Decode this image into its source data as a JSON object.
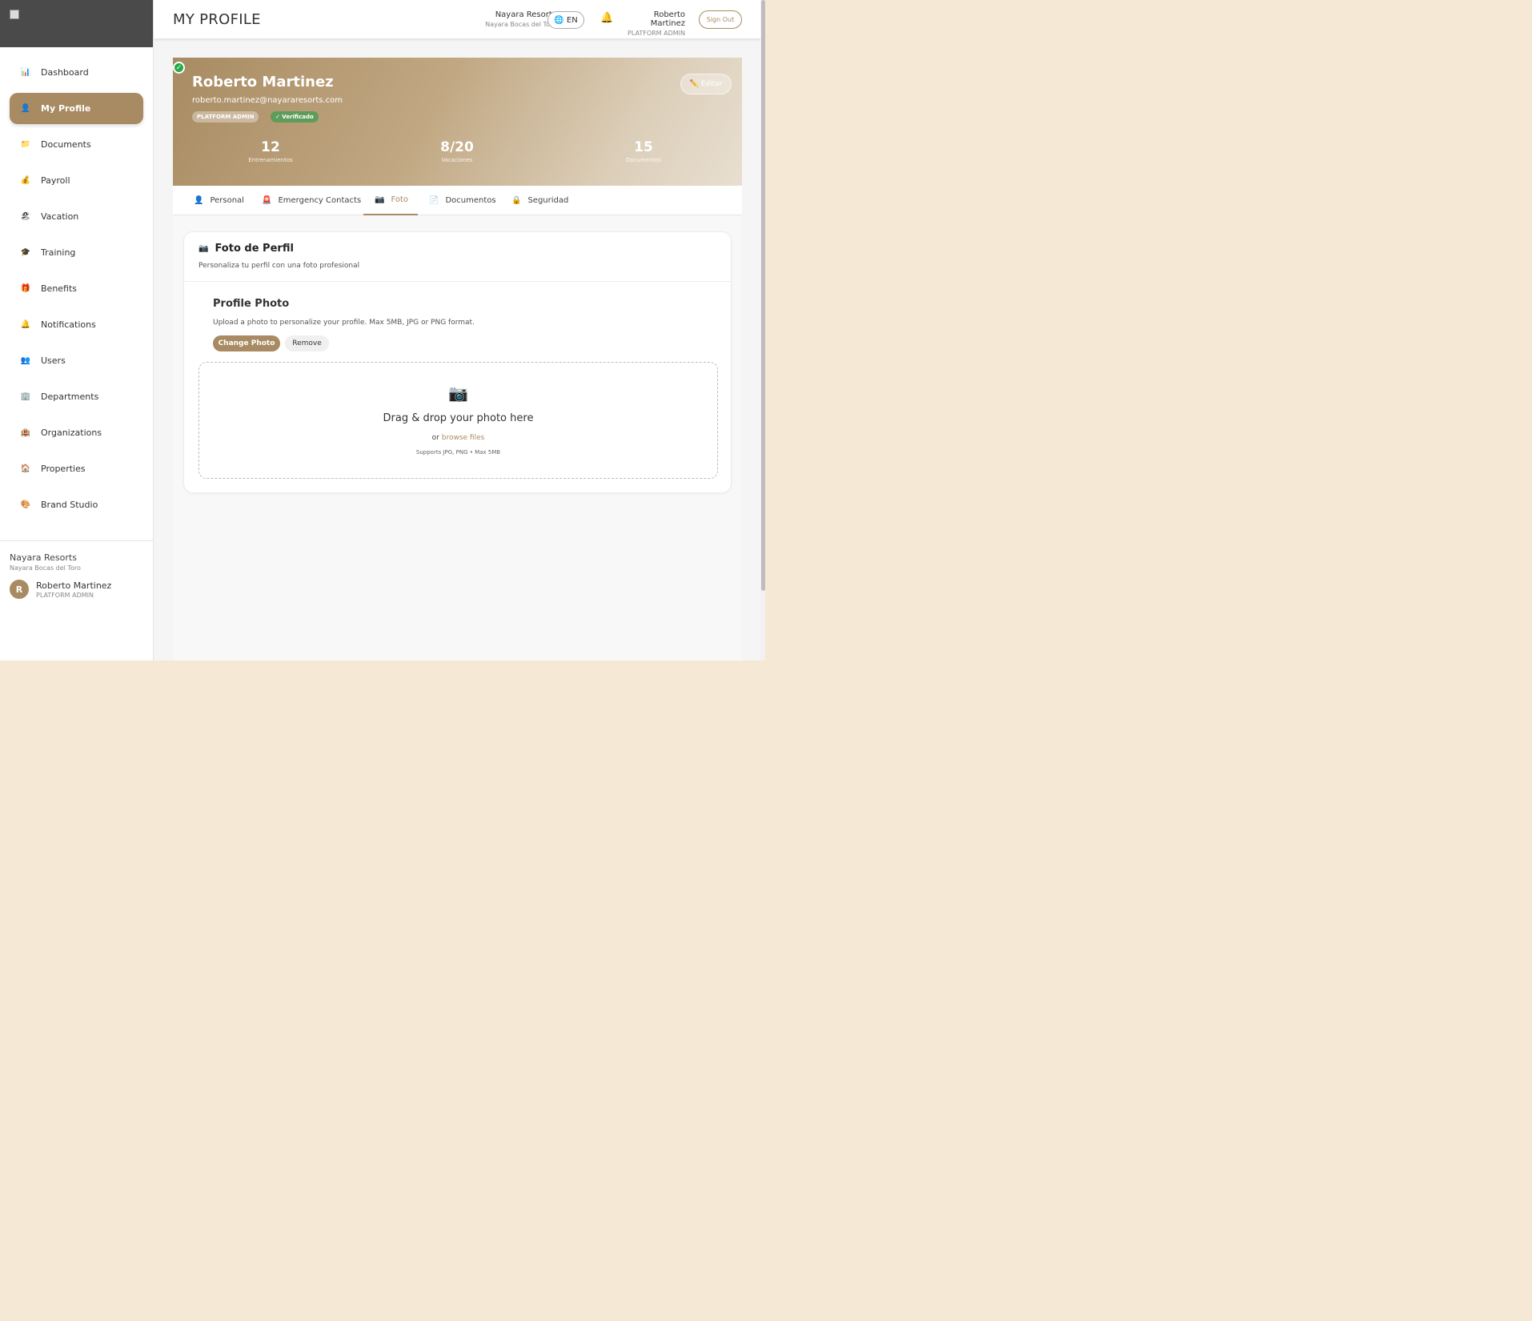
{
  "sidebar": {
    "items": [
      {
        "label": "Dashboard",
        "icon": "chart-icon",
        "glyph": "📊"
      },
      {
        "label": "My Profile",
        "icon": "user-icon",
        "glyph": "👤"
      },
      {
        "label": "Documents",
        "icon": "folder-icon",
        "glyph": "📁"
      },
      {
        "label": "Payroll",
        "icon": "money-bag-icon",
        "glyph": "💰"
      },
      {
        "label": "Vacation",
        "icon": "beach-icon",
        "glyph": "🏖"
      },
      {
        "label": "Training",
        "icon": "graduation-cap-icon",
        "glyph": "🎓"
      },
      {
        "label": "Benefits",
        "icon": "gift-icon",
        "glyph": "🎁"
      },
      {
        "label": "Notifications",
        "icon": "bell-icon",
        "glyph": "🔔"
      },
      {
        "label": "Users",
        "icon": "users-icon",
        "glyph": "👥"
      },
      {
        "label": "Departments",
        "icon": "office-building-icon",
        "glyph": "🏢"
      },
      {
        "label": "Organizations",
        "icon": "hotel-icon",
        "glyph": "🏨"
      },
      {
        "label": "Properties",
        "icon": "house-icon",
        "glyph": "🏠"
      },
      {
        "label": "Brand Studio",
        "icon": "palette-icon",
        "glyph": "🎨"
      }
    ],
    "footer": {
      "org": "Nayara Resorts",
      "property": "Nayara Bocas del Toro",
      "avatar_initial": "R",
      "user_name": "Roberto Martinez",
      "user_role": "PLATFORM ADMIN"
    }
  },
  "header": {
    "title": "MY PROFILE",
    "org": "Nayara Resorts",
    "property": "Nayara Bocas del Toro",
    "language": "🌐 EN",
    "user_name": "Roberto Martinez",
    "user_role": "PLATFORM ADMIN",
    "sign_out": "Sign Out"
  },
  "profile": {
    "name": "Roberto Martinez",
    "email": "roberto.martinez@nayararesorts.com",
    "role_badge": "PLATFORM ADMIN",
    "verified_badge": "✓ Verificado",
    "edit_label": "✏️ Editar",
    "stats": [
      {
        "value": "12",
        "label": "Entrenamientos"
      },
      {
        "value": "8/20",
        "label": "Vacaciones"
      },
      {
        "value": "15",
        "label": "Documentos"
      }
    ]
  },
  "tabs": [
    {
      "label": "Personal",
      "icon": "user-icon",
      "glyph": "👤"
    },
    {
      "label": "Emergency Contacts",
      "icon": "siren-icon",
      "glyph": "🚨"
    },
    {
      "label": "Foto",
      "icon": "camera-icon",
      "glyph": "📷"
    },
    {
      "label": "Documentos",
      "icon": "document-icon",
      "glyph": "📄"
    },
    {
      "label": "Seguridad",
      "icon": "lock-icon",
      "glyph": "🔒"
    }
  ],
  "active_tab": "Foto",
  "photo_card": {
    "title": "Foto de Perfil",
    "subtitle": "Personaliza tu perfil con una foto profesional",
    "section_title": "Profile Photo",
    "section_desc": "Upload a photo to personalize your profile. Max 5MB, JPG or PNG format.",
    "change_label": "Change Photo",
    "remove_label": "Remove",
    "dropzone": {
      "icon": "📷",
      "title": "Drag & drop your photo here",
      "or_text": "or",
      "browse_link": "browse files",
      "note": "Supports JPG, PNG • Max 5MB"
    }
  },
  "colors": {
    "accent": "#a88b62",
    "verified": "#27a84a",
    "page_background": "#f5e9d6"
  }
}
